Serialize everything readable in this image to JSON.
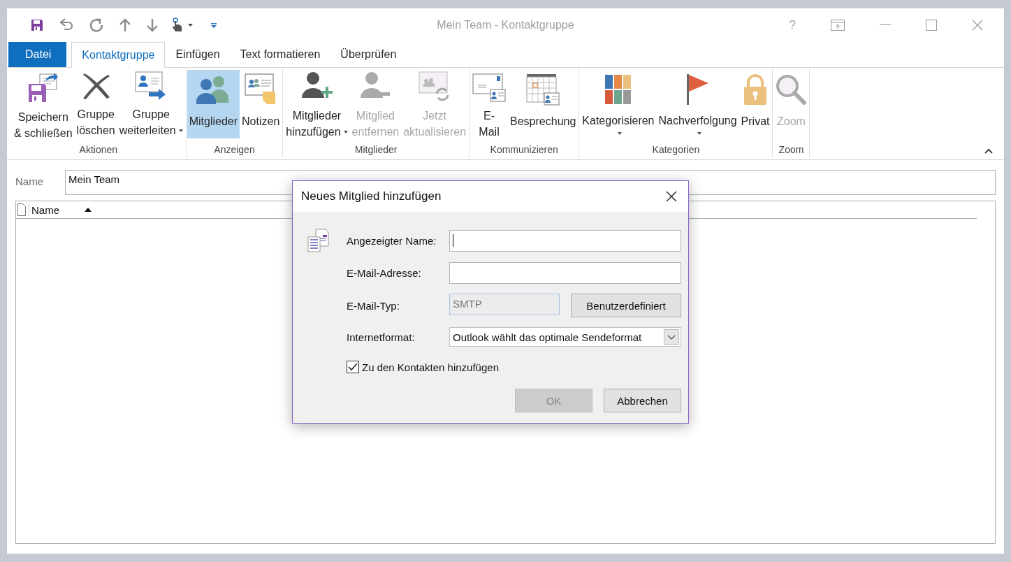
{
  "window": {
    "title": "Mein Team - Kontaktgruppe",
    "help_glyph": "?"
  },
  "tabs": [
    {
      "label": "Datei",
      "kind": "file",
      "selected": false
    },
    {
      "label": "Kontaktgruppe",
      "kind": "tab",
      "selected": true
    },
    {
      "label": "Einfügen",
      "kind": "tab",
      "selected": false
    },
    {
      "label": "Text formatieren",
      "kind": "tab",
      "selected": false
    },
    {
      "label": "Überprüfen",
      "kind": "tab",
      "selected": false
    }
  ],
  "ribbon": {
    "groups": [
      {
        "label": "Aktionen",
        "buttons": [
          {
            "lines": [
              "Speichern",
              "& schließen"
            ],
            "dropdown": false,
            "disabled": false,
            "selected": false
          },
          {
            "lines": [
              "Gruppe",
              "löschen"
            ],
            "dropdown": false,
            "disabled": false,
            "selected": false
          },
          {
            "lines": [
              "Gruppe",
              "weiterleiten"
            ],
            "dropdown": true,
            "disabled": false,
            "selected": false
          }
        ]
      },
      {
        "label": "Anzeigen",
        "buttons": [
          {
            "lines": [
              "Mitglieder"
            ],
            "dropdown": false,
            "disabled": false,
            "selected": true
          },
          {
            "lines": [
              "Notizen"
            ],
            "dropdown": false,
            "disabled": false,
            "selected": false
          }
        ]
      },
      {
        "label": "Mitglieder",
        "buttons": [
          {
            "lines": [
              "Mitglieder",
              "hinzufügen"
            ],
            "dropdown": true,
            "disabled": false,
            "selected": false
          },
          {
            "lines": [
              "Mitglied",
              "entfernen"
            ],
            "dropdown": false,
            "disabled": true,
            "selected": false
          },
          {
            "lines": [
              "Jetzt",
              "aktualisieren"
            ],
            "dropdown": false,
            "disabled": true,
            "selected": false
          }
        ]
      },
      {
        "label": "Kommunizieren",
        "buttons": [
          {
            "lines": [
              "E-",
              "Mail"
            ],
            "dropdown": false,
            "disabled": false,
            "selected": false
          },
          {
            "lines": [
              "Besprechung"
            ],
            "dropdown": false,
            "disabled": false,
            "selected": false
          }
        ]
      },
      {
        "label": "Kategorien",
        "buttons": [
          {
            "lines": [
              "Kategorisieren"
            ],
            "dropdown": true,
            "disabled": false,
            "selected": false
          },
          {
            "lines": [
              "Nachverfolgung"
            ],
            "dropdown": true,
            "disabled": false,
            "selected": false
          },
          {
            "lines": [
              "Privat"
            ],
            "dropdown": false,
            "disabled": false,
            "selected": false
          }
        ]
      },
      {
        "label": "Zoom",
        "buttons": [
          {
            "lines": [
              "Zoom"
            ],
            "dropdown": false,
            "disabled": true,
            "selected": false
          }
        ]
      }
    ]
  },
  "form": {
    "name_label": "Name",
    "name_value": "Mein Team",
    "list": {
      "columns": [
        {
          "label": "Name",
          "sort_ascending": true
        }
      ]
    }
  },
  "dialog": {
    "title": "Neues Mitglied hinzufügen",
    "fields": [
      {
        "label": "Angezeigter Name:",
        "kind": "text",
        "focused": true
      },
      {
        "label": "E-Mail-Adresse:",
        "kind": "text",
        "focused": false
      },
      {
        "label": "E-Mail-Typ:",
        "kind": "readonly",
        "value": "SMTP",
        "button": "Benutzerdefiniert"
      },
      {
        "label": "Internetformat:",
        "kind": "select",
        "value": "Outlook wählt das optimale Sendeformat"
      }
    ],
    "checkbox": {
      "label": "Zu den Kontakten hinzufügen",
      "checked": true
    },
    "buttons": [
      {
        "label": "OK",
        "disabled": true
      },
      {
        "label": "Abbrechen",
        "disabled": false
      }
    ]
  }
}
